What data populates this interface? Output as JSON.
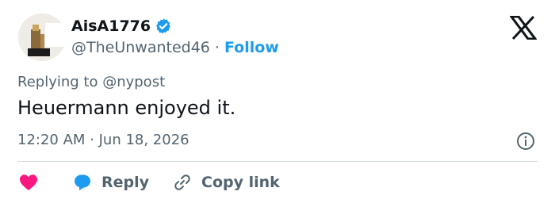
{
  "author": {
    "display_name": "AisA1776",
    "handle": "@TheUnwanted46",
    "separator": "·",
    "follow_label": "Follow",
    "verified_color": "#1d9bf0"
  },
  "reply_context": "Replying to @nypost",
  "tweet": {
    "text": "Heuermann enjoyed it.",
    "timestamp": "12:20 AM · Jun 18, 2026"
  },
  "actions": {
    "like_color": "#f91880",
    "reply_color": "#1d9bf0",
    "reply_label": "Reply",
    "copy_label": "Copy link"
  },
  "icons": [
    "x-logo-icon",
    "verified-badge-icon",
    "info-icon",
    "heart-icon",
    "reply-bubble-icon",
    "link-icon"
  ]
}
